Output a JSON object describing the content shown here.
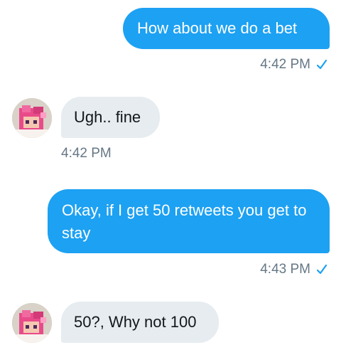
{
  "messages": [
    {
      "direction": "outgoing",
      "text": "How about we do a bet",
      "time": "4:42 PM",
      "read_icon": "checkmark-icon"
    },
    {
      "direction": "incoming",
      "text": "Ugh.. fine",
      "time": "4:42 PM"
    },
    {
      "direction": "outgoing",
      "text": "Okay, if I get 50 retweets you get to stay",
      "time": "4:43 PM",
      "read_icon": "checkmark-icon"
    },
    {
      "direction": "incoming",
      "text": "50?, Why not 100"
    }
  ],
  "colors": {
    "outgoing_bubble": "#1da1f2",
    "incoming_bubble": "#e6ecf0",
    "timestamp": "#657786",
    "checkmark": "#1da1f2"
  }
}
